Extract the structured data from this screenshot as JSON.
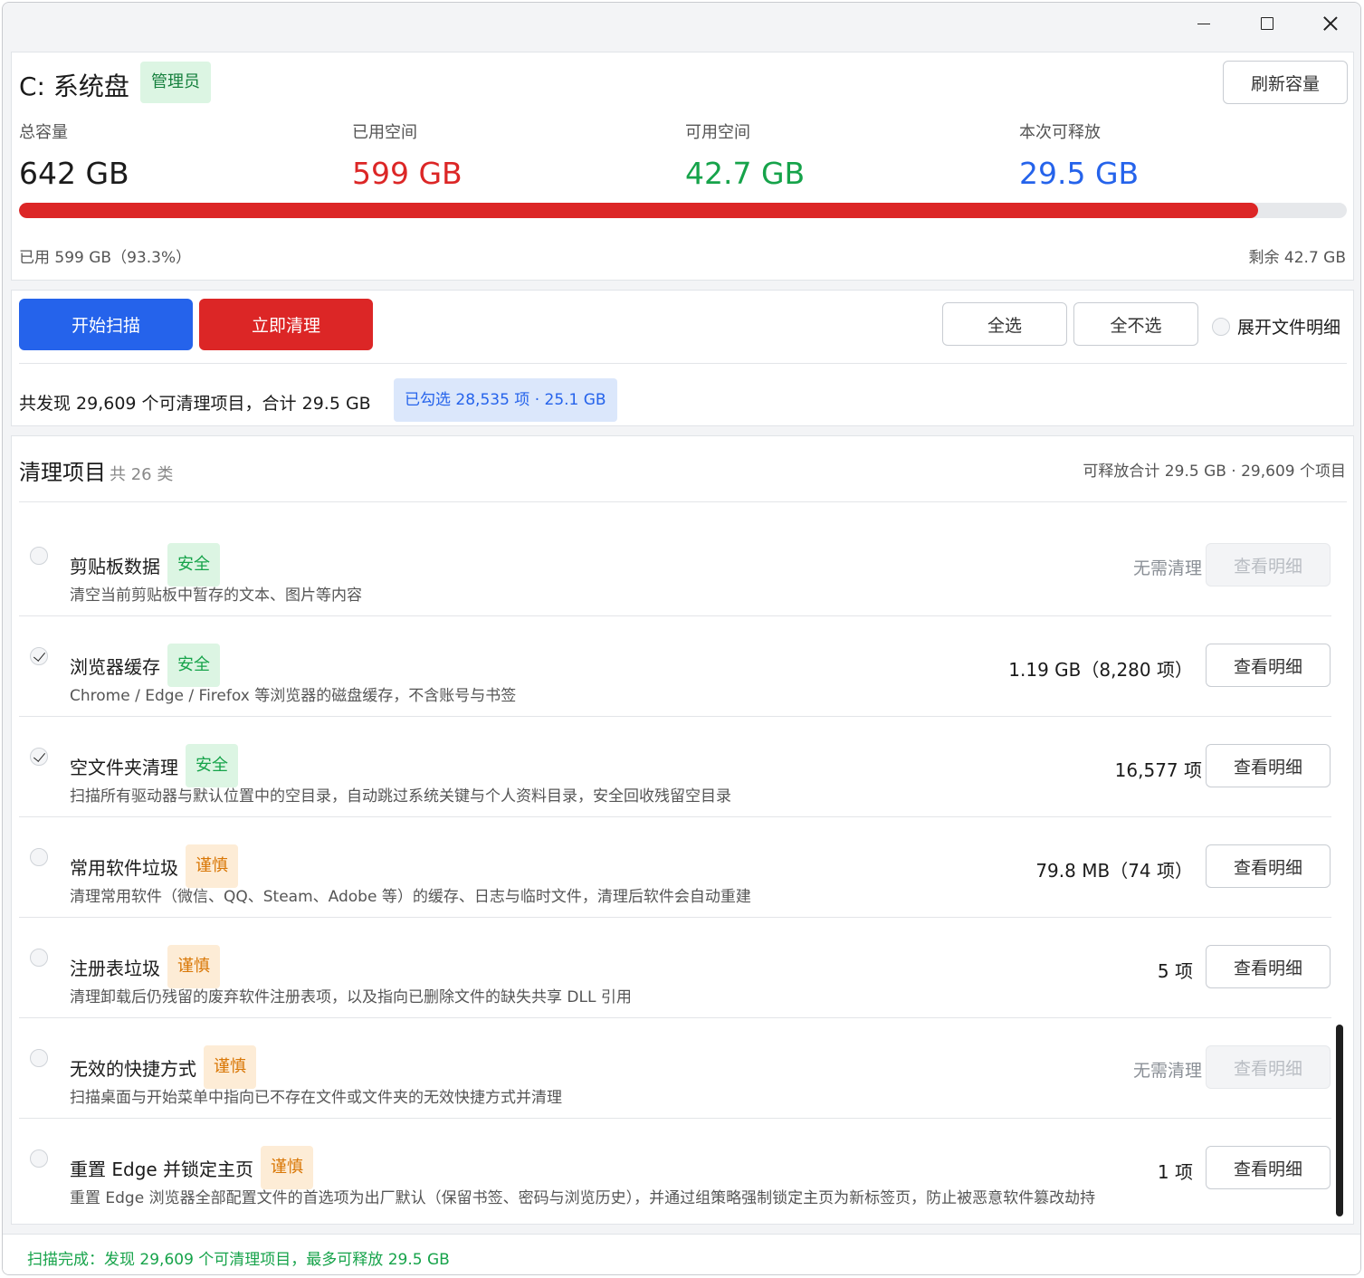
{
  "drive": {
    "title": "C: 系统盘",
    "admin_badge": "管理员",
    "refresh_label": "刷新容量",
    "stats": {
      "total_label": "总容量",
      "total_value": "642 GB",
      "used_label": "已用空间",
      "used_value": "599 GB",
      "free_label": "可用空间",
      "free_value": "42.7 GB",
      "release_label": "本次可释放",
      "release_value": "29.5 GB"
    },
    "usage_percent": 93.3,
    "used_text": "已用 599 GB（93.3%）",
    "remain_text": "剩余 42.7 GB",
    "colors": {
      "used": "#dc2626",
      "free": "#16a34a",
      "release": "#2563eb"
    }
  },
  "actions": {
    "scan_label": "开始扫描",
    "clean_label": "立即清理",
    "select_all_label": "全选",
    "select_none_label": "全不选",
    "expand_label": "展开文件明细",
    "found_text": "共发现 29,609 个可清理项目，合计 29.5 GB",
    "selected_badge": "已勾选 28,535 项 · 25.1 GB"
  },
  "list": {
    "title": "清理项目",
    "count": "共 26 类",
    "summary": "可释放合计 29.5 GB · 29,609 个项目",
    "items": [
      {
        "name": "剪贴板数据",
        "tag": "安全",
        "desc": "清空当前剪贴板中暂存的文本、图片等内容",
        "amount": "无需清理",
        "detail": "查看明细"
      },
      {
        "name": "浏览器缓存",
        "tag": "安全",
        "desc": "Chrome / Edge / Firefox 等浏览器的磁盘缓存，不含账号与书签",
        "amount": "1.19 GB（8,280 项）",
        "detail": "查看明细"
      },
      {
        "name": "空文件夹清理",
        "tag": "安全",
        "desc": "扫描所有驱动器与默认位置中的空目录，自动跳过系统关键与个人资料目录，安全回收残留空目录",
        "amount": "16,577 项",
        "detail": "查看明细"
      },
      {
        "name": "常用软件垃圾",
        "tag": "谨慎",
        "desc": "清理常用软件（微信、QQ、Steam、Adobe 等）的缓存、日志与临时文件，清理后软件会自动重建",
        "amount": "79.8 MB（74 项）",
        "detail": "查看明细"
      },
      {
        "name": "注册表垃圾",
        "tag": "谨慎",
        "desc": "清理卸载后仍残留的废弃软件注册表项，以及指向已删除文件的缺失共享 DLL 引用",
        "amount": "5 项",
        "detail": "查看明细"
      },
      {
        "name": "无效的快捷方式",
        "tag": "谨慎",
        "desc": "扫描桌面与开始菜单中指向已不存在文件或文件夹的无效快捷方式并清理",
        "amount": "无需清理",
        "detail": "查看明细"
      },
      {
        "name": "重置 Edge 并锁定主页",
        "tag": "谨慎",
        "desc": "重置 Edge 浏览器全部配置文件的首选项为出厂默认（保留书签、密码与浏览历史），并通过组策略强制锁定主页为新标签页，防止被恶意软件篡改劫持",
        "amount": "1 项",
        "detail": "查看明细"
      }
    ]
  },
  "status": "扫描完成：发现 29,609 个可清理项目，最多可释放 29.5 GB"
}
